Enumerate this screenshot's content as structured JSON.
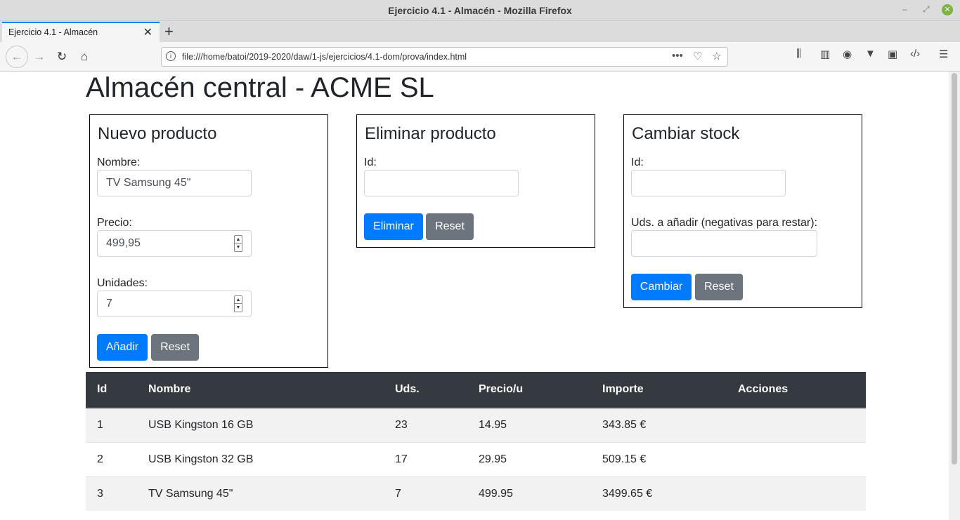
{
  "window": {
    "title": "Ejercicio 4.1 - Almacén - Mozilla Firefox"
  },
  "tab": {
    "label": "Ejercicio 4.1 - Almacén"
  },
  "urlbar": {
    "url": "file:///home/batoi/2019-2020/daw/1-js/ejercicios/4.1-dom/prova/index.html"
  },
  "page": {
    "title": "Almacén central - ACME SL"
  },
  "nuevo": {
    "title": "Nuevo producto",
    "nombre_label": "Nombre:",
    "nombre_value": "TV Samsung 45\"",
    "precio_label": "Precio:",
    "precio_value": "499,95",
    "unidades_label": "Unidades:",
    "unidades_value": "7",
    "add_label": "Añadir",
    "reset_label": "Reset"
  },
  "eliminar": {
    "title": "Eliminar producto",
    "id_label": "Id:",
    "id_value": "",
    "delete_label": "Eliminar",
    "reset_label": "Reset"
  },
  "cambiar": {
    "title": "Cambiar stock",
    "id_label": "Id:",
    "id_value": "",
    "uds_label": "Uds. a añadir (negativas para restar):",
    "uds_value": "",
    "change_label": "Cambiar",
    "reset_label": "Reset"
  },
  "table": {
    "headers": [
      "Id",
      "Nombre",
      "Uds.",
      "Precio/u",
      "Importe",
      "Acciones"
    ],
    "rows": [
      [
        "1",
        "USB Kingston 16 GB",
        "23",
        "14.95",
        "343.85 €",
        ""
      ],
      [
        "2",
        "USB Kingston 32 GB",
        "17",
        "29.95",
        "509.15 €",
        ""
      ],
      [
        "3",
        "TV Samsung 45\"",
        "7",
        "499.95",
        "3499.65 €",
        ""
      ]
    ]
  }
}
